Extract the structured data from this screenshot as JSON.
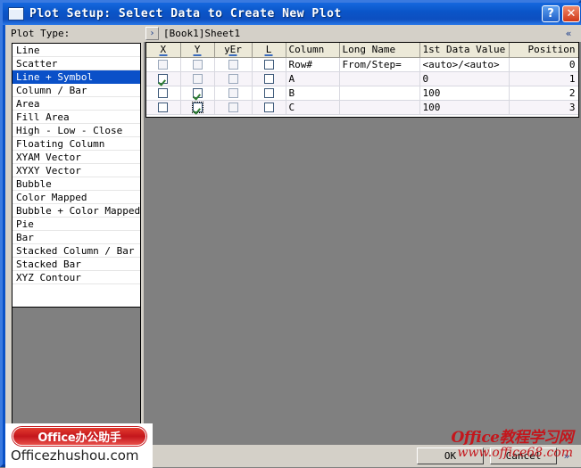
{
  "window": {
    "title": "Plot Setup: Select Data to Create New Plot",
    "icon": "plot-window-icon",
    "help_label": "?",
    "close_label": "✕"
  },
  "left_panel": {
    "label": "Plot Type:",
    "selected": "Line + Symbol",
    "items": [
      {
        "label": "Line"
      },
      {
        "label": "Scatter"
      },
      {
        "label": "Line + Symbol"
      },
      {
        "label": "Column / Bar"
      },
      {
        "label": "Area"
      },
      {
        "label": "Fill Area"
      },
      {
        "label": "High - Low - Close"
      },
      {
        "label": "Floating Column"
      },
      {
        "label": "XYAM Vector"
      },
      {
        "label": "XYXY Vector"
      },
      {
        "label": "Bubble"
      },
      {
        "label": "Color Mapped"
      },
      {
        "label": "Bubble + Color Mapped"
      },
      {
        "label": "Pie"
      },
      {
        "label": "Bar"
      },
      {
        "label": "Stacked Column / Bar"
      },
      {
        "label": "Stacked Bar"
      },
      {
        "label": "XYZ Contour"
      }
    ]
  },
  "sheet_bar": {
    "expand_icon": "›",
    "sheet_name": "[Book1]Sheet1",
    "collapse_icon": "«"
  },
  "grid": {
    "columns": [
      {
        "key": "x",
        "label": "X",
        "align": "check"
      },
      {
        "key": "y",
        "label": "Y",
        "align": "check"
      },
      {
        "key": "yer",
        "label": "yEr",
        "align": "check"
      },
      {
        "key": "l",
        "label": "L",
        "align": "check"
      },
      {
        "key": "column",
        "label": "Column",
        "align": "left"
      },
      {
        "key": "long",
        "label": "Long Name",
        "align": "left"
      },
      {
        "key": "first",
        "label": "1st Data Value",
        "align": "left"
      },
      {
        "key": "pos",
        "label": "Position",
        "align": "right"
      }
    ],
    "rows": [
      {
        "x": false,
        "y": false,
        "yer": false,
        "l": false,
        "x_dim": true,
        "y_dim": true,
        "yer_dim": true,
        "l_dim": false,
        "column": "Row#",
        "long": "From/Step=",
        "first": "<auto>/<auto>",
        "pos": "0",
        "focus": ""
      },
      {
        "x": true,
        "y": false,
        "yer": false,
        "l": false,
        "x_dim": false,
        "y_dim": true,
        "yer_dim": true,
        "l_dim": false,
        "column": "A",
        "long": "",
        "first": "0",
        "pos": "1",
        "focus": ""
      },
      {
        "x": false,
        "y": true,
        "yer": false,
        "l": false,
        "x_dim": false,
        "y_dim": false,
        "yer_dim": true,
        "l_dim": false,
        "column": "B",
        "long": "",
        "first": "100",
        "pos": "2",
        "focus": ""
      },
      {
        "x": false,
        "y": true,
        "yer": false,
        "l": false,
        "x_dim": false,
        "y_dim": false,
        "yer_dim": true,
        "l_dim": false,
        "column": "C",
        "long": "",
        "first": "100",
        "pos": "3",
        "focus": "y"
      }
    ]
  },
  "bottom_bar": {
    "ok_label": "OK",
    "cancel_label": "Cancel",
    "more_icon": "»"
  },
  "watermarks": {
    "left_badge": "Office办公助手",
    "left_url": "Officezhushou.com",
    "right_title": "Office教程学习网",
    "right_url": "www.office68.com"
  }
}
